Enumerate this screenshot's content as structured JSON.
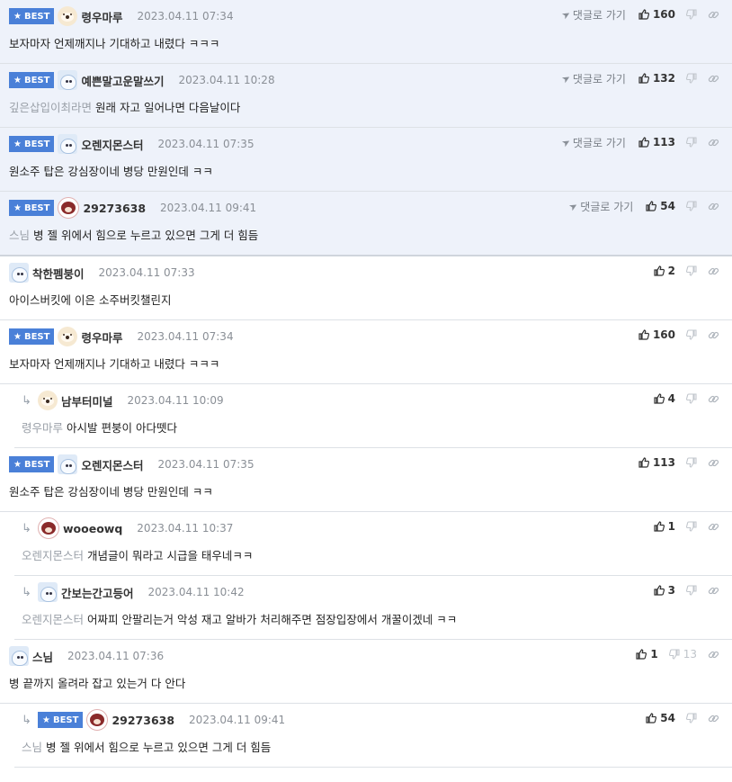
{
  "labels": {
    "best": "BEST",
    "goto": "댓글로 가기"
  },
  "comments": [
    {
      "best": true,
      "reply": false,
      "avatar": "dog-icon",
      "nick": "령우마루",
      "date": "2023.04.11 07:34",
      "mention": "",
      "text": "보자마자 언제깨지나 기대하고 내렸다 ㅋㅋㅋ",
      "goto": true,
      "likes": "160",
      "dislikes": ""
    },
    {
      "best": true,
      "reply": false,
      "avatar": "seal-icon",
      "nick": "예쁜말고운말쓰기",
      "date": "2023.04.11 10:28",
      "mention": "깊은삽입이최라면",
      "text": "원래 자고 일어나면 다음날이다",
      "goto": true,
      "likes": "132",
      "dislikes": ""
    },
    {
      "best": true,
      "reply": false,
      "avatar": "seal-icon",
      "nick": "오렌지몬스터",
      "date": "2023.04.11 07:35",
      "mention": "",
      "text": "원소주 탑은 강심장이네 병당 만원인데 ㅋㅋ",
      "goto": true,
      "likes": "113",
      "dislikes": ""
    },
    {
      "best": true,
      "reply": false,
      "avatar": "cup-icon",
      "nick": "29273638",
      "date": "2023.04.11 09:41",
      "mention": "스님",
      "text": "병 젤 위에서 힘으로 누르고 있으면 그게 더 힘듬",
      "goto": true,
      "likes": "54",
      "dislikes": ""
    },
    {
      "best": false,
      "reply": false,
      "avatar": "seal-icon",
      "nick": "착한펨붕이",
      "date": "2023.04.11 07:33",
      "mention": "",
      "text": "아이스버킷에 이은 소주버킷챌린지",
      "goto": false,
      "likes": "2",
      "dislikes": ""
    },
    {
      "best": true,
      "reply": false,
      "avatar": "dog-icon",
      "nick": "령우마루",
      "date": "2023.04.11 07:34",
      "mention": "",
      "text": "보자마자 언제깨지나 기대하고 내렸다 ㅋㅋㅋ",
      "goto": false,
      "likes": "160",
      "dislikes": ""
    },
    {
      "best": false,
      "reply": true,
      "avatar": "dog-icon",
      "nick": "남부터미널",
      "date": "2023.04.11 10:09",
      "mention": "령우마루",
      "text": "아시발 편붕이 아다뗏다",
      "goto": false,
      "likes": "4",
      "dislikes": ""
    },
    {
      "best": true,
      "reply": false,
      "avatar": "seal-icon",
      "nick": "오렌지몬스터",
      "date": "2023.04.11 07:35",
      "mention": "",
      "text": "원소주 탑은 강심장이네 병당 만원인데 ㅋㅋ",
      "goto": false,
      "likes": "113",
      "dislikes": ""
    },
    {
      "best": false,
      "reply": true,
      "avatar": "cup-icon",
      "nick": "wooeowq",
      "date": "2023.04.11 10:37",
      "mention": "오렌지몬스터",
      "text": "개념글이 뭐라고 시급을 태우네ㅋㅋ",
      "goto": false,
      "likes": "1",
      "dislikes": ""
    },
    {
      "best": false,
      "reply": true,
      "avatar": "seal-icon",
      "nick": "간보는간고등어",
      "date": "2023.04.11 10:42",
      "mention": "오렌지몬스터",
      "text": "어짜피 안팔리는거 악성 재고 알바가 처리해주면 점장입장에서 개꿀이겠네 ㅋㅋ",
      "goto": false,
      "likes": "3",
      "dislikes": ""
    },
    {
      "best": false,
      "reply": false,
      "avatar": "seal-icon",
      "nick": "스님",
      "date": "2023.04.11 07:36",
      "mention": "",
      "text": "병 끝까지 올려라 잡고 있는거 다 안다",
      "goto": false,
      "likes": "1",
      "dislikes": "13"
    },
    {
      "best": true,
      "reply": true,
      "avatar": "cup-icon",
      "nick": "29273638",
      "date": "2023.04.11 09:41",
      "mention": "스님",
      "text": "병 젤 위에서 힘으로 누르고 있으면 그게 더 힘듬",
      "goto": false,
      "likes": "54",
      "dislikes": ""
    }
  ],
  "colors": {
    "best_badge": "#4a80d8",
    "best_bg": "#eef2fa",
    "mention": "#9aa0a8"
  }
}
